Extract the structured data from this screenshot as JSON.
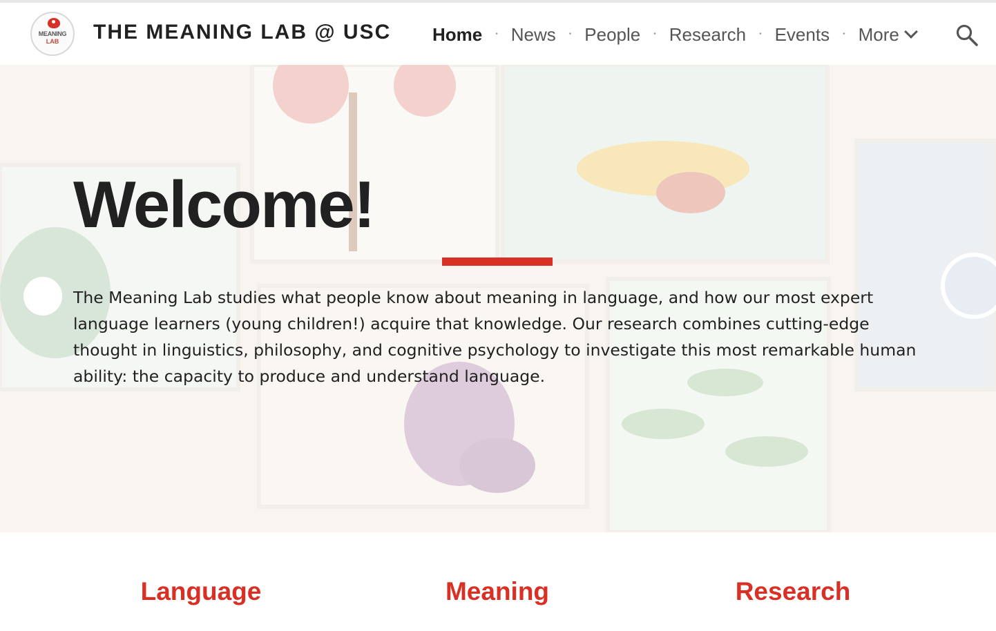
{
  "site": {
    "title": "THE MEANING LAB @ USC",
    "logo": {
      "line1": "MEANING",
      "line2": "LAB",
      "icon": "bird-logo"
    }
  },
  "nav": {
    "items": [
      {
        "label": "Home",
        "active": true
      },
      {
        "label": "News",
        "active": false
      },
      {
        "label": "People",
        "active": false
      },
      {
        "label": "Research",
        "active": false
      },
      {
        "label": "Events",
        "active": false
      },
      {
        "label": "More",
        "active": false,
        "icon": "chevron-down-icon"
      }
    ],
    "search_icon": "search-icon"
  },
  "hero": {
    "heading": "Welcome!",
    "intro": "The Meaning Lab studies what people know about meaning in language, and how our most expert language learners (young children!) acquire that knowledge. Our research combines cutting-edge thought in linguistics, philosophy, and cognitive psychology to investigate this most remarkable human ability: the capacity to produce and understand language."
  },
  "sections": [
    {
      "label": "Language"
    },
    {
      "label": "Meaning"
    },
    {
      "label": "Research"
    }
  ],
  "colors": {
    "accent": "#d93025",
    "text": "#212121",
    "nav_text": "#555555"
  }
}
